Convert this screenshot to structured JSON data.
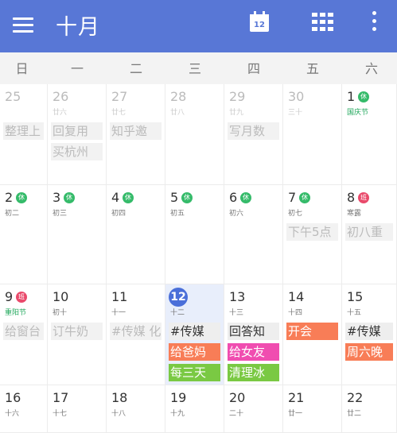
{
  "appbar": {
    "title": "十月",
    "today_icon_number": "12",
    "bg_color": "#5877d6"
  },
  "weekdays": [
    "日",
    "一",
    "二",
    "三",
    "四",
    "五",
    "六"
  ],
  "rows": [
    [
      {
        "day": "25",
        "muted": true,
        "events": [
          {
            "text": "整理上",
            "style": "gray-muted"
          }
        ]
      },
      {
        "day": "26",
        "lunar": "廿六",
        "muted": true,
        "events": [
          {
            "text": "回复用",
            "style": "gray-muted"
          },
          {
            "text": "买杭州",
            "style": "gray-muted"
          }
        ]
      },
      {
        "day": "27",
        "lunar": "廿七",
        "muted": true,
        "events": [
          {
            "text": "知乎邀",
            "style": "gray-muted"
          }
        ]
      },
      {
        "day": "28",
        "lunar": "廿八",
        "muted": true,
        "events": []
      },
      {
        "day": "29",
        "lunar": "廿九",
        "muted": true,
        "events": [
          {
            "text": "写月数",
            "style": "gray-muted"
          }
        ]
      },
      {
        "day": "30",
        "lunar": "三十",
        "muted": true,
        "events": []
      },
      {
        "day": "1",
        "lunar": "国庆节",
        "lunar_green": true,
        "badge": "休",
        "events": []
      }
    ],
    [
      {
        "day": "2",
        "lunar": "初二",
        "badge": "休",
        "events": []
      },
      {
        "day": "3",
        "lunar": "初三",
        "badge": "休",
        "events": []
      },
      {
        "day": "4",
        "lunar": "初四",
        "badge": "休",
        "events": []
      },
      {
        "day": "5",
        "lunar": "初五",
        "badge": "休",
        "events": []
      },
      {
        "day": "6",
        "lunar": "初六",
        "badge": "休",
        "events": []
      },
      {
        "day": "7",
        "lunar": "初七",
        "badge": "休",
        "events": [
          {
            "text": "下午5点",
            "style": "gray-muted"
          }
        ]
      },
      {
        "day": "8",
        "lunar": "寒露",
        "badge": "班",
        "badge_red": true,
        "events": [
          {
            "text": "初八重",
            "style": "gray-muted"
          }
        ]
      }
    ],
    [
      {
        "day": "9",
        "lunar": "重阳节",
        "lunar_green": true,
        "badge": "班",
        "badge_red": true,
        "events": [
          {
            "text": "给窗台",
            "style": "gray-muted"
          }
        ]
      },
      {
        "day": "10",
        "lunar": "初十",
        "events": [
          {
            "text": "订牛奶",
            "style": "gray-muted"
          }
        ]
      },
      {
        "day": "11",
        "lunar": "十一",
        "events": [
          {
            "text": "#传媒 化",
            "style": "gray-muted"
          }
        ]
      },
      {
        "day": "12",
        "lunar": "十二",
        "today": true,
        "events": [
          {
            "text": "#传媒",
            "style": "gray"
          },
          {
            "text": "给爸妈",
            "style": "orange"
          },
          {
            "text": "每三天",
            "style": "green"
          }
        ]
      },
      {
        "day": "13",
        "lunar": "十三",
        "events": [
          {
            "text": "回答知",
            "style": "gray"
          },
          {
            "text": "给女友",
            "style": "pink"
          },
          {
            "text": "清理冰",
            "style": "green"
          }
        ]
      },
      {
        "day": "14",
        "lunar": "十四",
        "events": [
          {
            "text": "开会",
            "style": "orange"
          }
        ]
      },
      {
        "day": "15",
        "lunar": "十五",
        "events": [
          {
            "text": "#传媒",
            "style": "gray"
          },
          {
            "text": "周六晚",
            "style": "orange"
          }
        ]
      }
    ],
    [
      {
        "day": "16",
        "lunar": "十六",
        "events": []
      },
      {
        "day": "17",
        "lunar": "十七",
        "events": []
      },
      {
        "day": "18",
        "lunar": "十八",
        "events": []
      },
      {
        "day": "19",
        "lunar": "十九",
        "events": []
      },
      {
        "day": "20",
        "lunar": "二十",
        "events": []
      },
      {
        "day": "21",
        "lunar": "廿一",
        "events": []
      },
      {
        "day": "22",
        "lunar": "廿二",
        "events": []
      }
    ]
  ]
}
